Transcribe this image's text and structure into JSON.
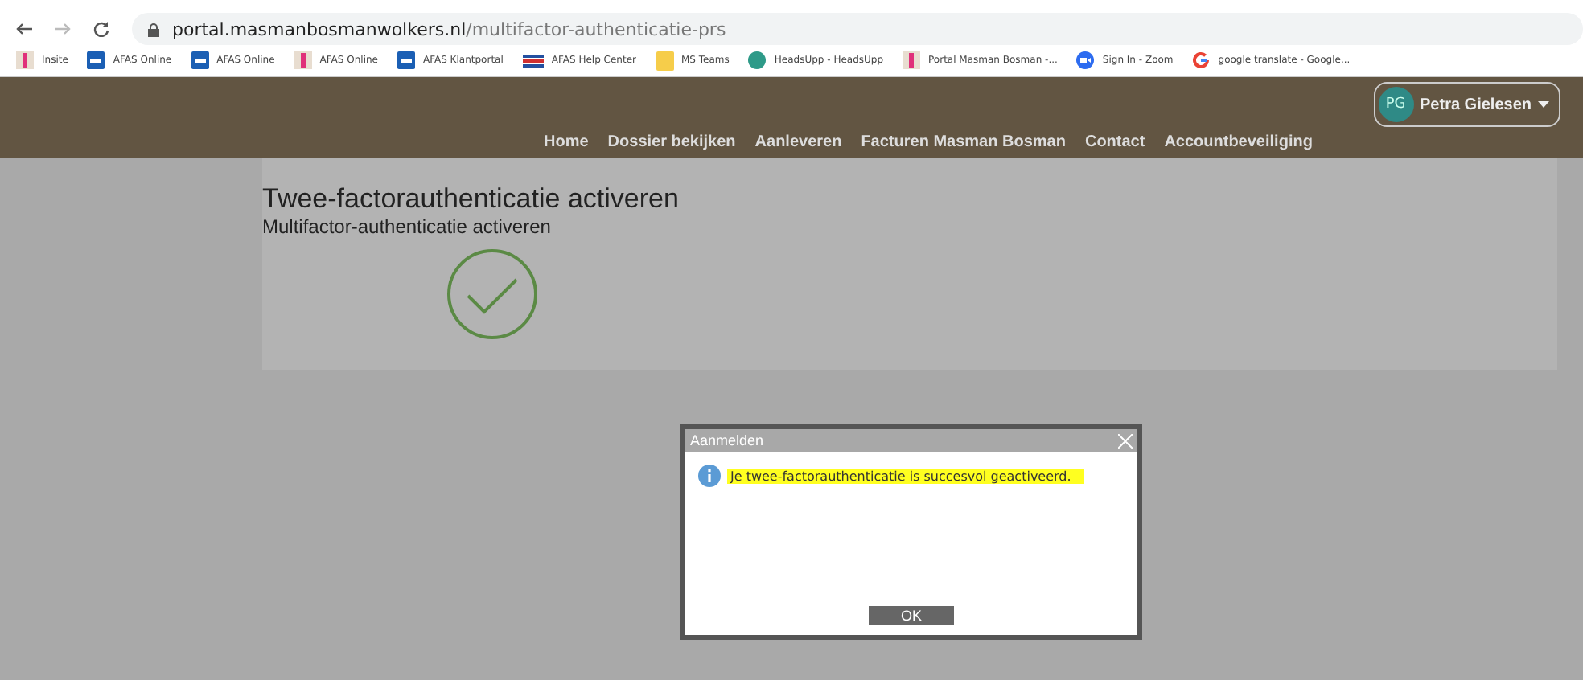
{
  "browser": {
    "url_host": "portal.masmanbosmanwolkers.nl",
    "url_path": "/multifactor-authenticatie-prs",
    "bookmarks": [
      {
        "label": "Insite",
        "kind": "page"
      },
      {
        "label": "AFAS Online",
        "kind": "afas"
      },
      {
        "label": "AFAS Online",
        "kind": "afas"
      },
      {
        "label": "AFAS Online",
        "kind": "page"
      },
      {
        "label": "AFAS Klantportal",
        "kind": "afas"
      },
      {
        "label": "AFAS Help Center",
        "kind": "help"
      },
      {
        "label": "MS Teams",
        "kind": "folder"
      },
      {
        "label": "HeadsUpp - HeadsUpp",
        "kind": "circle"
      },
      {
        "label": "Portal Masman Bosman -...",
        "kind": "page"
      },
      {
        "label": "Sign In - Zoom",
        "kind": "zoom"
      },
      {
        "label": "google translate - Google...",
        "kind": "google"
      }
    ]
  },
  "header": {
    "user": {
      "initials": "PG",
      "name": "Petra Gielesen"
    },
    "nav": [
      "Home",
      "Dossier bekijken",
      "Aanleveren",
      "Facturen Masman Bosman",
      "Contact",
      "Accountbeveiliging"
    ]
  },
  "content": {
    "title": "Twee-factorauthenticatie activeren",
    "subtitle": "Multifactor-authenticatie activeren"
  },
  "dialog": {
    "title": "Aanmelden",
    "message": "Je twee-factorauthenticatie is succesvol geactiveerd.",
    "button": "OK"
  }
}
